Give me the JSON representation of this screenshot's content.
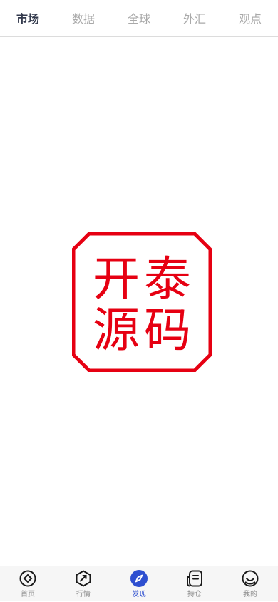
{
  "top_tabs": [
    {
      "label": "市场",
      "active": true
    },
    {
      "label": "数据",
      "active": false
    },
    {
      "label": "全球",
      "active": false
    },
    {
      "label": "外汇",
      "active": false
    },
    {
      "label": "观点",
      "active": false
    }
  ],
  "seal": {
    "text": [
      "开",
      "泰",
      "源",
      "码"
    ],
    "color": "#e60012"
  },
  "bottom_nav": [
    {
      "label": "首页",
      "icon": "home-diamond-icon",
      "active": false
    },
    {
      "label": "行情",
      "icon": "market-trend-icon",
      "active": false
    },
    {
      "label": "发现",
      "icon": "compass-icon",
      "active": true
    },
    {
      "label": "持仓",
      "icon": "position-document-icon",
      "active": false
    },
    {
      "label": "我的",
      "icon": "profile-smile-icon",
      "active": false
    }
  ],
  "colors": {
    "accent": "#2e4fd0",
    "active_tab": "#333a4d",
    "inactive": "#a9a9a9"
  }
}
